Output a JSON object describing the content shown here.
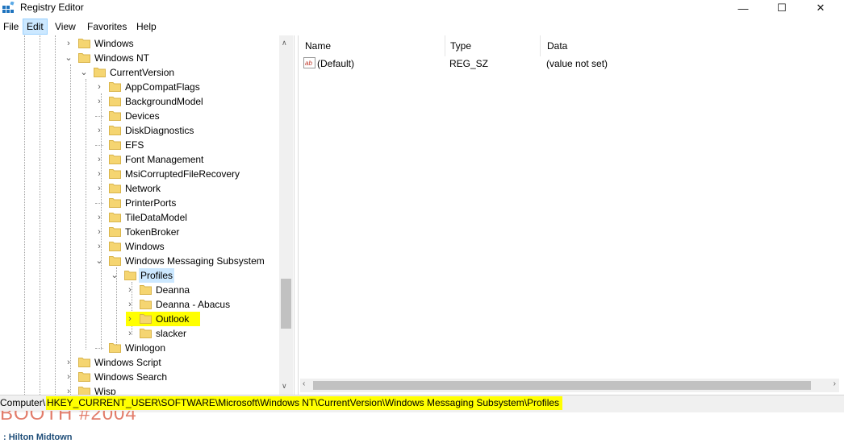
{
  "window": {
    "title": "Registry Editor",
    "minimize_glyph": "—",
    "maximize_glyph": "☐",
    "close_glyph": "✕"
  },
  "menu": [
    "File",
    "Edit",
    "View",
    "Favorites",
    "Help"
  ],
  "tree": [
    {
      "label": "Windows",
      "expander": "›",
      "selected": false,
      "highlighted": false
    },
    {
      "label": "Windows NT",
      "expander": "⌄",
      "selected": false,
      "highlighted": false
    },
    {
      "label": "CurrentVersion",
      "expander": "⌄",
      "selected": false,
      "highlighted": false
    },
    {
      "label": "AppCompatFlags",
      "expander": "›",
      "selected": false,
      "highlighted": false
    },
    {
      "label": "BackgroundModel",
      "expander": "›",
      "selected": false,
      "highlighted": false
    },
    {
      "label": "Devices",
      "expander": "",
      "selected": false,
      "highlighted": false
    },
    {
      "label": "DiskDiagnostics",
      "expander": "›",
      "selected": false,
      "highlighted": false
    },
    {
      "label": "EFS",
      "expander": "",
      "selected": false,
      "highlighted": false
    },
    {
      "label": "Font Management",
      "expander": "›",
      "selected": false,
      "highlighted": false
    },
    {
      "label": "MsiCorruptedFileRecovery",
      "expander": "›",
      "selected": false,
      "highlighted": false
    },
    {
      "label": "Network",
      "expander": "›",
      "selected": false,
      "highlighted": false
    },
    {
      "label": "PrinterPorts",
      "expander": "",
      "selected": false,
      "highlighted": false
    },
    {
      "label": "TileDataModel",
      "expander": "›",
      "selected": false,
      "highlighted": false
    },
    {
      "label": "TokenBroker",
      "expander": "›",
      "selected": false,
      "highlighted": false
    },
    {
      "label": "Windows",
      "expander": "›",
      "selected": false,
      "highlighted": false
    },
    {
      "label": "Windows Messaging Subsystem",
      "expander": "⌄",
      "selected": false,
      "highlighted": false
    },
    {
      "label": "Profiles",
      "expander": "⌄",
      "selected": true,
      "highlighted": false
    },
    {
      "label": "Deanna",
      "expander": "›",
      "selected": false,
      "highlighted": false
    },
    {
      "label": "Deanna - Abacus",
      "expander": "›",
      "selected": false,
      "highlighted": false
    },
    {
      "label": "Outlook",
      "expander": "›",
      "selected": false,
      "highlighted": true
    },
    {
      "label": "slacker",
      "expander": "›",
      "selected": false,
      "highlighted": false
    },
    {
      "label": "Winlogon",
      "expander": "",
      "selected": false,
      "highlighted": false
    },
    {
      "label": "Windows Script",
      "expander": "›",
      "selected": false,
      "highlighted": false
    },
    {
      "label": "Windows Search",
      "expander": "›",
      "selected": false,
      "highlighted": false
    },
    {
      "label": "Wisp",
      "expander": "›",
      "selected": false,
      "highlighted": false
    }
  ],
  "list": {
    "columns": [
      "Name",
      "Type",
      "Data"
    ],
    "rows": [
      {
        "name": "(Default)",
        "type": "REG_SZ",
        "data": "(value not set)",
        "icon": "string-value-icon"
      }
    ]
  },
  "status": {
    "prefix": "Computer\\",
    "path": "HKEY_CURRENT_USER\\SOFTWARE\\Microsoft\\Windows NT\\CurrentVersion\\Windows Messaging Subsystem\\Profiles"
  },
  "background": {
    "banner": "BOOTH #2004",
    "venue": ": Hilton Midtown"
  },
  "colors": {
    "folder": "#f5d571",
    "highlight": "#ffff00",
    "selection": "#cce8ff"
  }
}
